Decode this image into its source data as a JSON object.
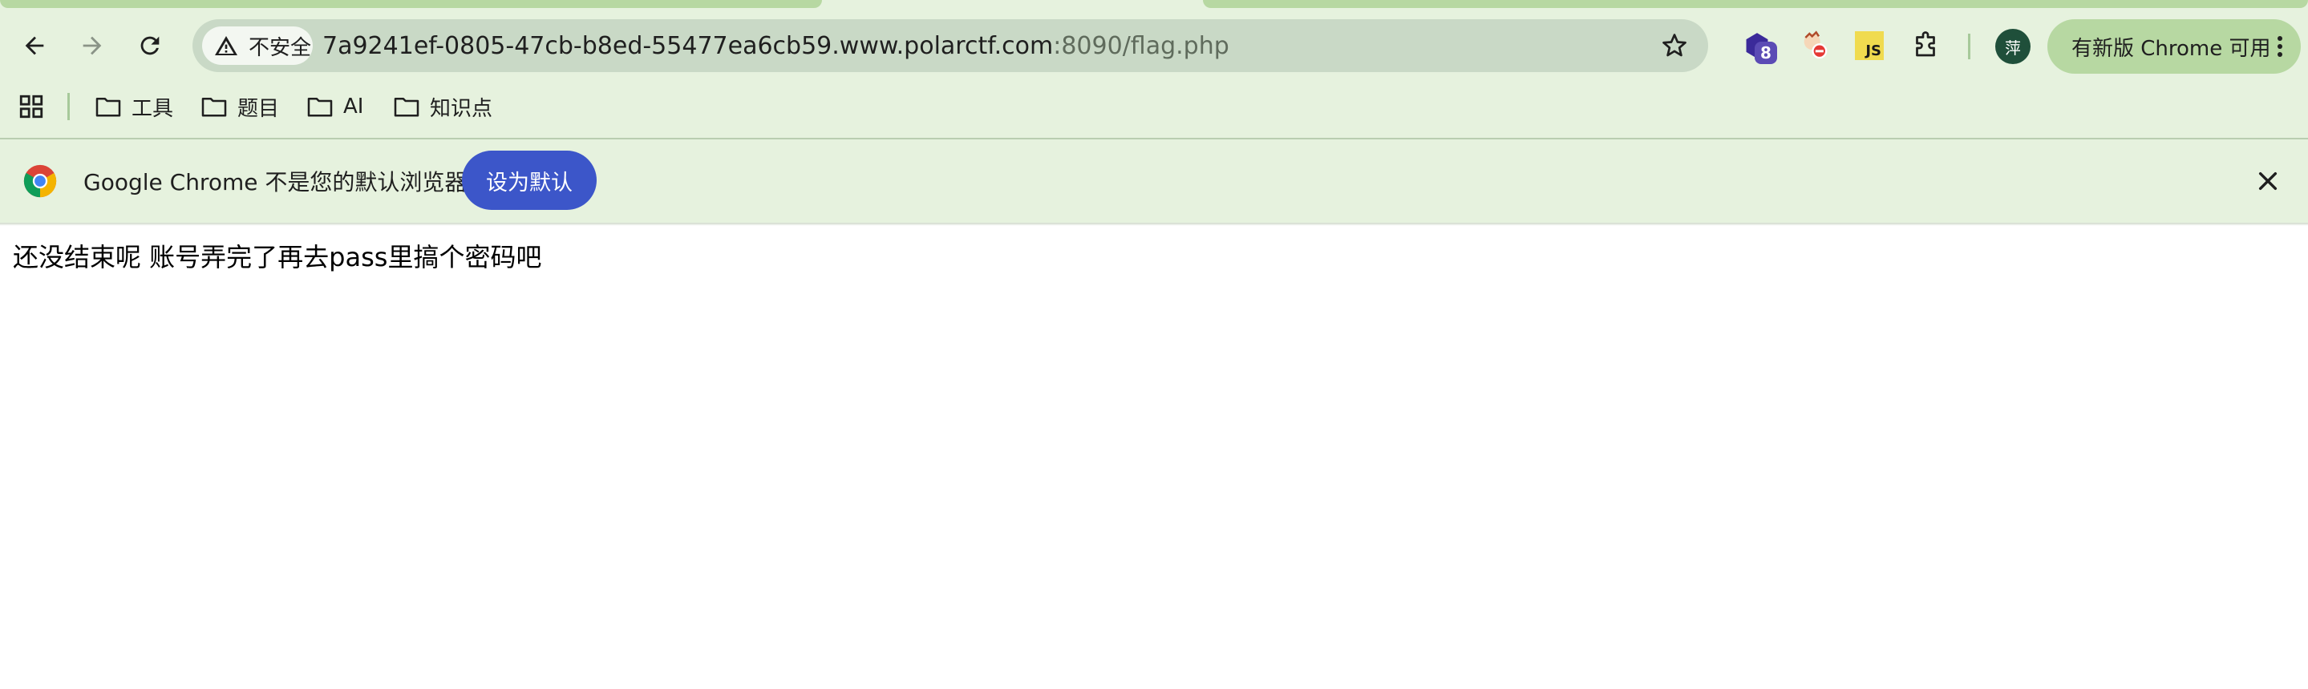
{
  "toolbar": {
    "security_label": "不安全",
    "url_host": "7a9241ef-0805-47cb-b8ed-55477ea6cb59.www.polarctf.com",
    "url_rest": ":8090/flag.php",
    "extension_badge": "8",
    "js_extension_label": "JS",
    "avatar_initial": "萍",
    "update_label": "有新版 Chrome 可用"
  },
  "bookmarks": {
    "items": [
      {
        "label": "工具"
      },
      {
        "label": "题目"
      },
      {
        "label": "AI"
      },
      {
        "label": "知识点"
      }
    ]
  },
  "infobar": {
    "message": "Google Chrome 不是您的默认浏览器",
    "button_label": "设为默认"
  },
  "page": {
    "text": "还没结束呢 账号弄完了再去pass里搞个密码吧"
  },
  "colors": {
    "chrome_bg": "#e6f2de",
    "omnibox_bg": "#c9d9c6",
    "accent_button": "#3c56c9",
    "update_button": "#b7d8a2"
  }
}
